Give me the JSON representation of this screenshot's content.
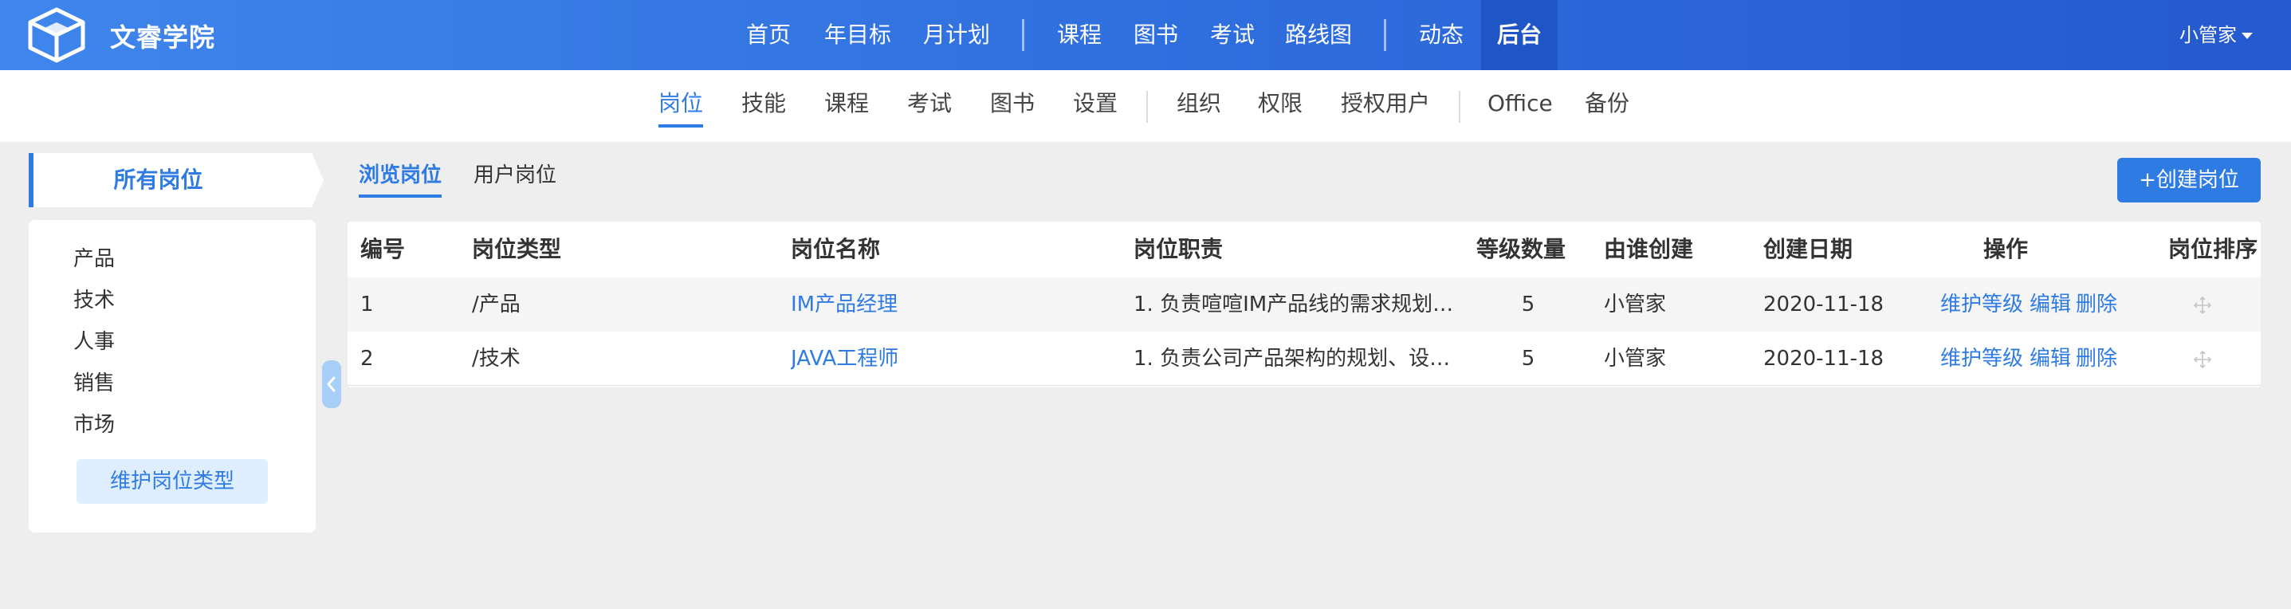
{
  "header": {
    "brand": "文睿学院",
    "nav": [
      {
        "label": "首页"
      },
      {
        "label": "年目标"
      },
      {
        "label": "月计划"
      },
      {
        "label": "课程"
      },
      {
        "label": "图书"
      },
      {
        "label": "考试"
      },
      {
        "label": "路线图"
      },
      {
        "label": "动态"
      },
      {
        "label": "后台",
        "active": true
      }
    ],
    "user": "小管家"
  },
  "subnav": [
    {
      "label": "岗位",
      "active": true
    },
    {
      "label": "技能"
    },
    {
      "label": "课程"
    },
    {
      "label": "考试"
    },
    {
      "label": "图书"
    },
    {
      "label": "设置"
    },
    {
      "label": "组织"
    },
    {
      "label": "权限"
    },
    {
      "label": "授权用户"
    },
    {
      "label": "Office"
    },
    {
      "label": "备份"
    }
  ],
  "sidebar": {
    "title": "所有岗位",
    "items": [
      {
        "label": "产品"
      },
      {
        "label": "技术"
      },
      {
        "label": "人事"
      },
      {
        "label": "销售"
      },
      {
        "label": "市场"
      }
    ],
    "maintain_label": "维护岗位类型"
  },
  "tabs": [
    {
      "label": "浏览岗位",
      "active": true
    },
    {
      "label": "用户岗位"
    }
  ],
  "create_button": "+创建岗位",
  "table": {
    "headers": [
      "编号",
      "岗位类型",
      "岗位名称",
      "岗位职责",
      "等级数量",
      "由谁创建",
      "创建日期",
      "操作",
      "岗位排序"
    ],
    "rows": [
      {
        "id": "1",
        "type": "/产品",
        "name": "IM产品经理",
        "duty": "1. 负责喧喧IM产品线的需求规划…",
        "levels": "5",
        "creator": "小管家",
        "date": "2020-11-18",
        "actions": [
          "维护等级",
          "编辑",
          "删除"
        ]
      },
      {
        "id": "2",
        "type": "/技术",
        "name": "JAVA工程师",
        "duty": "1. 负责公司产品架构的规划、设…",
        "levels": "5",
        "creator": "小管家",
        "date": "2020-11-18",
        "actions": [
          "维护等级",
          "编辑",
          "删除"
        ]
      }
    ]
  },
  "colors": {
    "primary": "#2f7be4",
    "header_start": "#3f86ec",
    "header_end": "#2559cf"
  }
}
